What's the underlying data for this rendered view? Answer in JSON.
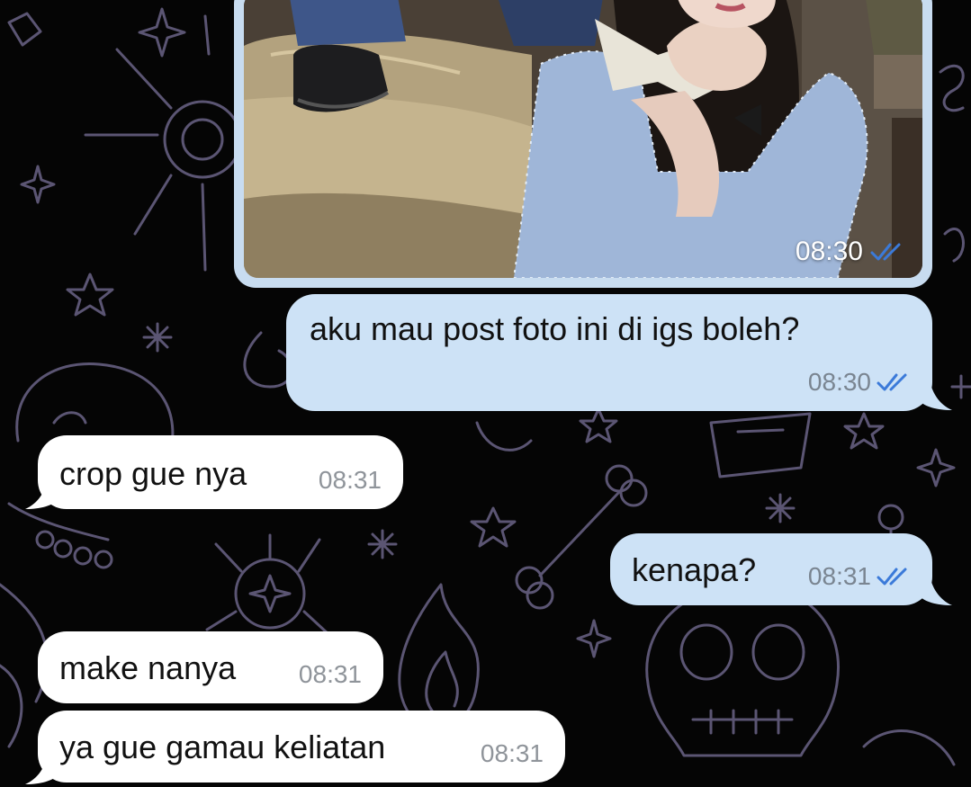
{
  "colors": {
    "outgoing_bubble": "#cde2f6",
    "incoming_bubble": "#ffffff",
    "read_check": "#3b7ad9",
    "background": "#050505",
    "doodle_stroke": "#5b5573"
  },
  "messages": [
    {
      "direction": "outgoing",
      "kind": "photo",
      "time": "08:30",
      "status_icon": "double-check-icon"
    },
    {
      "direction": "outgoing",
      "kind": "text",
      "text": "aku mau post foto ini di igs boleh?",
      "time": "08:30",
      "status_icon": "double-check-icon"
    },
    {
      "direction": "incoming",
      "kind": "text",
      "text": "crop gue nya",
      "time": "08:31"
    },
    {
      "direction": "outgoing",
      "kind": "text",
      "text": "kenapa?",
      "time": "08:31",
      "status_icon": "double-check-icon"
    },
    {
      "direction": "incoming",
      "kind": "text",
      "text": "make nanya",
      "time": "08:31"
    },
    {
      "direction": "incoming",
      "kind": "text",
      "text": "ya gue gamau keliatan",
      "time": "08:31"
    }
  ]
}
